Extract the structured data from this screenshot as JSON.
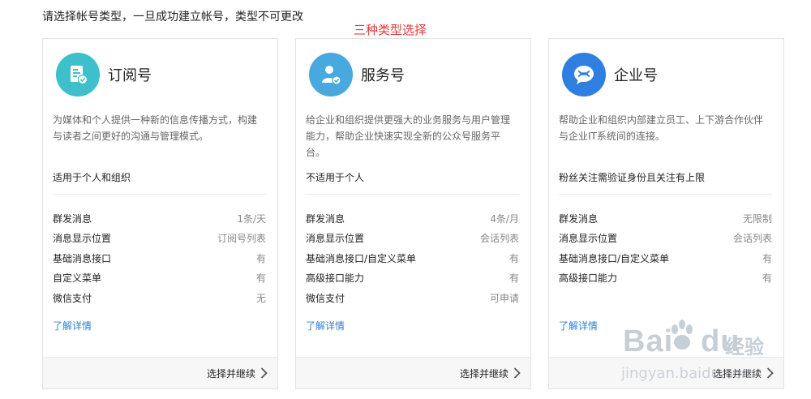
{
  "page": {
    "heading": "请选择帐号类型，一旦成功建立帐号，类型不可更改",
    "annotation": "三种类型选择"
  },
  "cards": [
    {
      "title": "订阅号",
      "icon": "document-check-icon",
      "icon_color": "#3dbfcc",
      "desc": "为媒体和个人提供一种新的信息传播方式，构建与读者之间更好的沟通与管理模式。",
      "suit": "适用于个人和组织",
      "features": [
        {
          "name": "群发消息",
          "value": "1条/天"
        },
        {
          "name": "消息显示位置",
          "value": "订阅号列表"
        },
        {
          "name": "基础消息接口",
          "value": "有"
        },
        {
          "name": "自定义菜单",
          "value": "有"
        },
        {
          "name": "微信支付",
          "value": "无"
        }
      ],
      "more": "了解详情",
      "footer": "选择并继续"
    },
    {
      "title": "服务号",
      "icon": "user-verified-icon",
      "icon_color": "#48a9de",
      "desc": "给企业和组织提供更强大的业务服务与用户管理能力，帮助企业快速实现全新的公众号服务平台。",
      "suit": "不适用于个人",
      "features": [
        {
          "name": "群发消息",
          "value": "4条/月"
        },
        {
          "name": "消息显示位置",
          "value": "会话列表"
        },
        {
          "name": "基础消息接口/自定义菜单",
          "value": "有"
        },
        {
          "name": "高级接口能力",
          "value": "有"
        },
        {
          "name": "微信支付",
          "value": "可申请"
        }
      ],
      "more": "了解详情",
      "footer": "选择并继续"
    },
    {
      "title": "企业号",
      "icon": "chat-bubble-icon",
      "icon_color": "#2e7fe0",
      "desc": "帮助企业和组织内部建立员工、上下游合作伙伴与企业IT系统间的连接。",
      "suit": "粉丝关注需验证身份且关注有上限",
      "features": [
        {
          "name": "群发消息",
          "value": "无限制"
        },
        {
          "name": "消息显示位置",
          "value": "会话列表"
        },
        {
          "name": "基础消息接口/自定义菜单",
          "value": "有"
        },
        {
          "name": "高级接口能力",
          "value": "有"
        }
      ],
      "more": "了解详情",
      "footer": "选择并继续"
    }
  ],
  "watermark": {
    "brand_left": "Bai",
    "brand_right": "du",
    "tag": "经验",
    "url": "jingyan.baidu.com"
  }
}
